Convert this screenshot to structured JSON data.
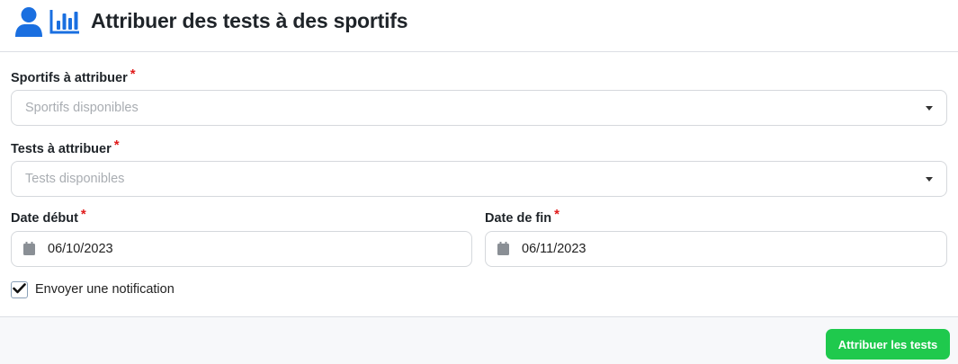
{
  "header": {
    "title": "Attribuer des tests à des sportifs",
    "icons": [
      "user-icon",
      "bar-chart-icon"
    ],
    "accent_color": "#1a6fe0"
  },
  "form": {
    "athletes": {
      "label": "Sportifs à attribuer",
      "required_mark": "*",
      "placeholder": "Sportifs disponibles"
    },
    "tests": {
      "label": "Tests à attribuer",
      "required_mark": "*",
      "placeholder": "Tests disponibles"
    },
    "start_date": {
      "label": "Date début",
      "required_mark": "*",
      "value": "06/10/2023"
    },
    "end_date": {
      "label": "Date de fin",
      "required_mark": "*",
      "value": "06/11/2023"
    },
    "notification": {
      "label": "Envoyer une notification",
      "checked": true
    }
  },
  "footer": {
    "submit_label": "Attribuer les tests",
    "submit_color": "#1fc94d"
  }
}
